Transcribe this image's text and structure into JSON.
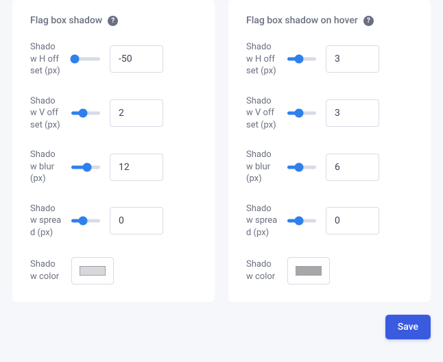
{
  "left": {
    "title": "Flag box shadow",
    "shadow_h_offset": {
      "label": "Shadow H offset (px)",
      "value": "-50",
      "slider_pct": 12
    },
    "shadow_v_offset": {
      "label": "Shadow V offset (px)",
      "value": "2",
      "slider_pct": 40
    },
    "shadow_blur": {
      "label": "Shadow blur (px)",
      "value": "12",
      "slider_pct": 55
    },
    "shadow_spread": {
      "label": "Shadow spread (px)",
      "value": "0",
      "slider_pct": 40
    },
    "shadow_color": {
      "label": "Shadow color",
      "value": "#d8d8d8"
    }
  },
  "right": {
    "title": "Flag box shadow on hover",
    "shadow_h_offset": {
      "label": "Shadow H offset (px)",
      "value": "3",
      "slider_pct": 40
    },
    "shadow_v_offset": {
      "label": "Shadow V offset (px)",
      "value": "3",
      "slider_pct": 40
    },
    "shadow_blur": {
      "label": "Shadow blur (px)",
      "value": "6",
      "slider_pct": 40
    },
    "shadow_spread": {
      "label": "Shadow spread (px)",
      "value": "0",
      "slider_pct": 40
    },
    "shadow_color": {
      "label": "Shadow color",
      "value": "#a7a7a7"
    }
  },
  "actions": {
    "save": "Save"
  }
}
